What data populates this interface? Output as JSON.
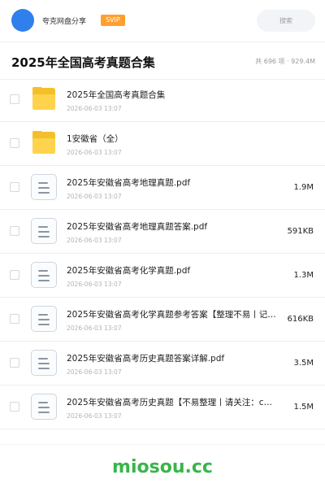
{
  "header": {
    "brand": "夸克网盘分享",
    "badge": "SVIP",
    "search_placeholder": "搜索"
  },
  "folder_view": {
    "title": "2025年全国高考真题合集",
    "summary": "共 696 项 · 929.4M"
  },
  "items": [
    {
      "type": "folder",
      "name": "2025年全国高考真题合集",
      "date": "2026-06-03 13:07",
      "size": ""
    },
    {
      "type": "folder",
      "name": "1安徽省（全）",
      "date": "2026-06-03 13:07",
      "size": ""
    },
    {
      "type": "file",
      "name": "2025年安徽省高考地理真题.pdf",
      "date": "2026-06-03 13:07",
      "size": "1.9M"
    },
    {
      "type": "file",
      "name": "2025年安徽省高考地理真题答案.pdf",
      "date": "2026-06-03 13:07",
      "size": "591KB"
    },
    {
      "type": "file",
      "name": "2025年安徽省高考化学真题.pdf",
      "date": "2026-06-03 13:07",
      "size": "1.3M"
    },
    {
      "type": "file",
      "name": "2025年安徽省高考化学真题参考答案【整理不易丨记…",
      "date": "2026-06-03 13:07",
      "size": "616KB"
    },
    {
      "type": "file",
      "name": "2025年安徽省高考历史真题答案详解.pdf",
      "date": "2026-06-03 13:07",
      "size": "3.5M"
    },
    {
      "type": "file",
      "name": "2025年安徽省高考历史真题【不易整理丨请关注：c…",
      "date": "2026-06-03 13:07",
      "size": "1.5M"
    }
  ],
  "watermark": "miosou.cc",
  "colors": {
    "accent": "#2f80ed",
    "badge": "#ff9f2f",
    "folder": "#ffd34d",
    "watermark": "#39b54a"
  }
}
